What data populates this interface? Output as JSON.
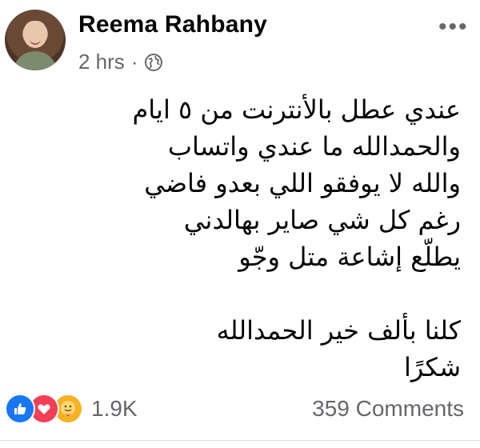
{
  "post": {
    "author_name": "Reema Rahbany",
    "timestamp": "2 hrs",
    "separator": "·",
    "privacy_icon": "globe-icon",
    "more_icon": "more-options-icon",
    "body_lines": [
      "عندي عطل بالأنترنت من ٥ ايام",
      "والحمدالله ما عندي واتساب",
      "والله لا يوفقو اللي بعدو فاضي",
      "رغم كل شي صاير بهالدني",
      "يطلّع إشاعة متل وجّو",
      "",
      "كلنا بألف خير الحمدالله",
      "شكرًا"
    ]
  },
  "footer": {
    "reaction_icons": [
      "like-icon",
      "love-icon",
      "care-icon"
    ],
    "reaction_count": "1.9K",
    "comments_count": "359 Comments"
  },
  "colors": {
    "like": "#1877f2",
    "love": "#f33e58",
    "care": "#f7b125",
    "secondary_text": "#65676b"
  }
}
